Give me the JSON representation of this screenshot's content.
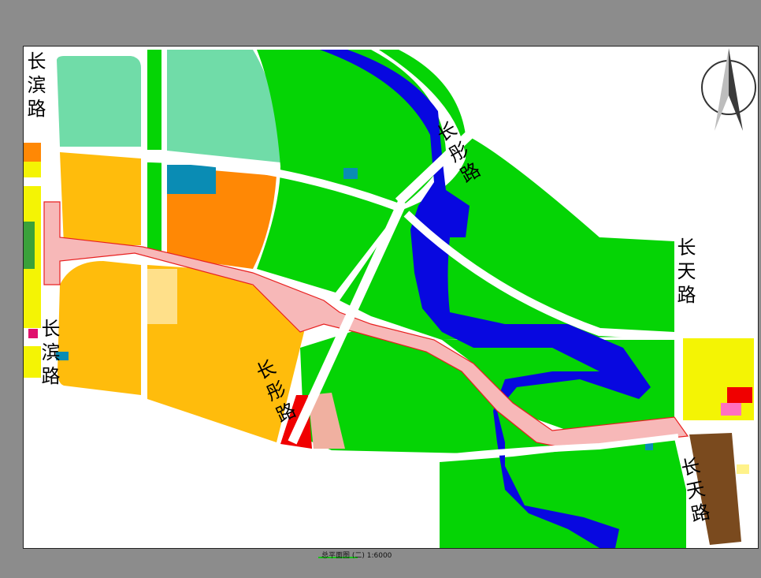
{
  "map": {
    "caption": "总平面图 (二) 1:6000",
    "roads": [
      {
        "id": "changbin-north",
        "name": "长滨路"
      },
      {
        "id": "changbin-south",
        "name": "长滨路"
      },
      {
        "id": "changtong-north",
        "name": "长彤路"
      },
      {
        "id": "changtong-south",
        "name": "长彤路"
      },
      {
        "id": "changtian-east",
        "name": "长天路"
      },
      {
        "id": "changtian-south",
        "name": "长天路"
      }
    ],
    "north_arrow": "north-arrow-icon",
    "colors": {
      "greenland": "#05d405",
      "water": "#0808e0",
      "residential_light": "#70dca8",
      "commercial_orange": "#ffbc0c",
      "commercial_dark_orange": "#ff8805",
      "yellow_residential": "#f4f404",
      "road_highlight": "#f7b8b8",
      "red_public": "#f00000",
      "brown_industrial": "#7a4a1e",
      "teal_facility": "#0a8cb4",
      "salmon": "#f0b0a0"
    }
  }
}
